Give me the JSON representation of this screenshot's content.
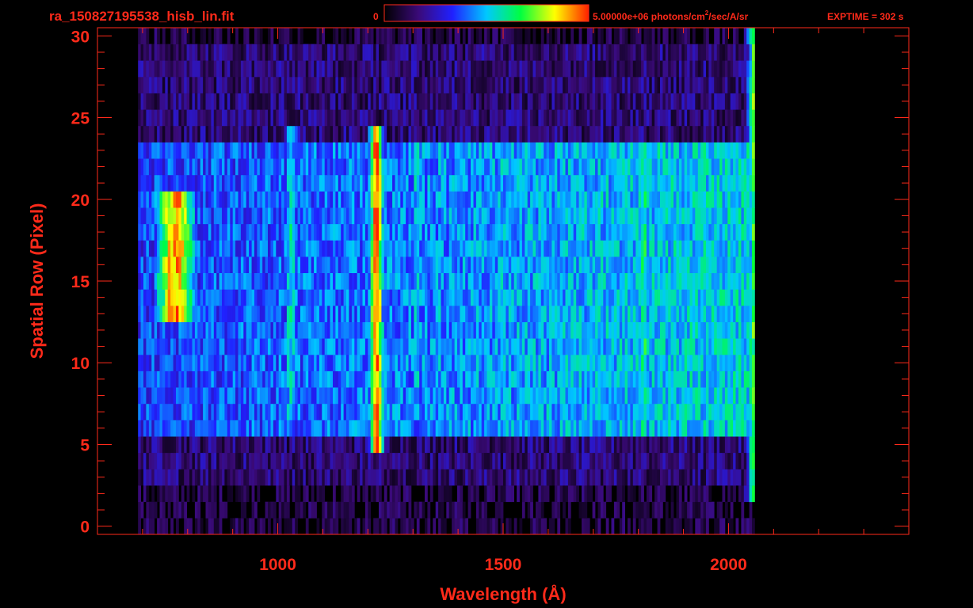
{
  "chart_data": {
    "type": "heatmap",
    "title": "ra_150827195538_hisb_lin.fit",
    "colorbar": {
      "min_label": "0",
      "max_label_prefix": "5.00000e+06 photons/cm",
      "max_label_sup": "2",
      "max_label_suffix": "/sec/A/sr",
      "stops": [
        "#000000",
        "#3a0a78",
        "#2020ff",
        "#00c8ff",
        "#00ff40",
        "#ffff00",
        "#ff2000"
      ]
    },
    "exptime_label": "EXPTIME = 302 s",
    "xlabel": "Wavelength (Å)",
    "ylabel": "Spatial Row (Pixel)",
    "xlim": [
      600,
      2400
    ],
    "ylim": [
      -0.5,
      30.5
    ],
    "x_ticks": [
      1000,
      1500,
      2000
    ],
    "x_tick_labels": [
      "1000",
      "1500",
      "2000"
    ],
    "y_ticks": [
      0,
      5,
      10,
      15,
      20,
      25,
      30
    ],
    "y_tick_labels": [
      "0",
      "5",
      "10",
      "15",
      "20",
      "25",
      "30"
    ],
    "data_extent": {
      "x_start": 690,
      "x_end": 2055,
      "rows": [
        0,
        30
      ]
    },
    "slit_rows": [
      6,
      23
    ],
    "features": [
      {
        "label": "Lyman-alpha emission",
        "wavelength": 1216,
        "rows": [
          5,
          24
        ],
        "level": 0.95
      },
      {
        "label": "emission",
        "wavelength": 1026,
        "rows": [
          7,
          24
        ],
        "level": 0.55
      },
      {
        "label": "emission",
        "wavelength": 1304,
        "rows": [
          7,
          23
        ],
        "level": 0.5
      },
      {
        "label": "emission",
        "wavelength": 1356,
        "rows": [
          7,
          23
        ],
        "level": 0.45
      },
      {
        "label": "emission",
        "wavelength": 1493,
        "rows": [
          7,
          23
        ],
        "level": 0.5
      },
      {
        "label": "emission",
        "wavelength": 1810,
        "rows": [
          6,
          23
        ],
        "level": 0.62
      },
      {
        "label": "bright blob",
        "wavelength": 770,
        "rows": [
          13,
          20
        ],
        "level": 0.9
      },
      {
        "label": "detector edge",
        "wavelength": 2055,
        "rows": [
          2,
          30
        ],
        "level": 0.7
      }
    ]
  }
}
